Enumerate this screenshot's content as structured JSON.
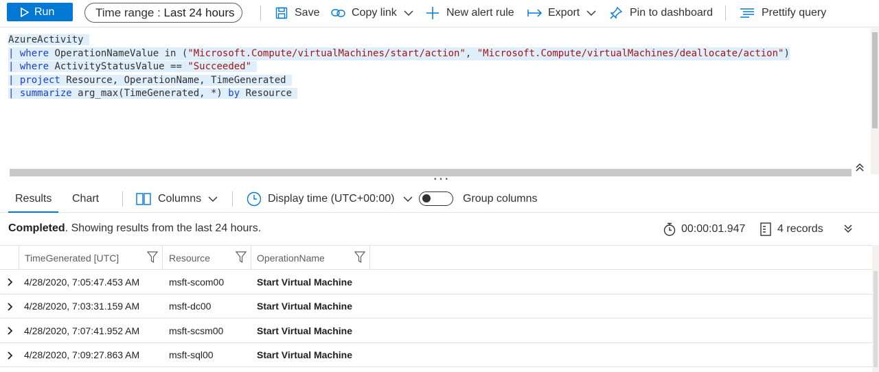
{
  "toolbar": {
    "run_label": "Run",
    "time_range_prefix": "Time range : ",
    "time_range_value": "Last 24 hours",
    "save_label": "Save",
    "copy_link_label": "Copy link",
    "new_alert_label": "New alert rule",
    "export_label": "Export",
    "pin_label": "Pin to dashboard",
    "prettify_label": "Prettify query"
  },
  "query": {
    "line1": "AzureActivity",
    "line2_kw": "where",
    "line2_field": " OperationNameValue in (",
    "line2_str1": "\"Microsoft.Compute/virtualMachines/start/action\"",
    "line2_comma": ", ",
    "line2_str2": "\"Microsoft.Compute/virtualMachines/deallocate/action\"",
    "line2_close": ")",
    "line3_kw": "where",
    "line3_field": " ActivityStatusValue == ",
    "line3_str": "\"Succeeded\"",
    "line4_kw": "project",
    "line4_rest": " Resource, OperationName, TimeGenerated",
    "line5_kw": "summarize",
    "line5_rest1": " arg_max(TimeGenerated, *) ",
    "line5_by": "by",
    "line5_rest2": " Resource"
  },
  "results_tabs": {
    "results_label": "Results",
    "chart_label": "Chart",
    "columns_label": "Columns",
    "display_time_label": "Display time (UTC+00:00)",
    "group_columns_label": "Group columns",
    "group_columns_on": false
  },
  "status": {
    "completed": "Completed",
    "message": ". Showing results from the last 24 hours.",
    "duration": "00:00:01.947",
    "records": "4 records"
  },
  "table": {
    "columns": [
      "TimeGenerated [UTC]",
      "Resource",
      "OperationName"
    ],
    "rows": [
      [
        "4/28/2020, 7:05:47.453 AM",
        "msft-scom00",
        "Start Virtual Machine"
      ],
      [
        "4/28/2020, 7:03:31.159 AM",
        "msft-dc00",
        "Start Virtual Machine"
      ],
      [
        "4/28/2020, 7:07:41.952 AM",
        "msft-scsm00",
        "Start Virtual Machine"
      ],
      [
        "4/28/2020, 7:09:27.863 AM",
        "msft-sql00",
        "Start Virtual Machine"
      ]
    ]
  },
  "colors": {
    "accent": "#0078d4",
    "keyword": "#1b3fd1",
    "string": "#a31515",
    "highlight": "#dfeefb"
  }
}
